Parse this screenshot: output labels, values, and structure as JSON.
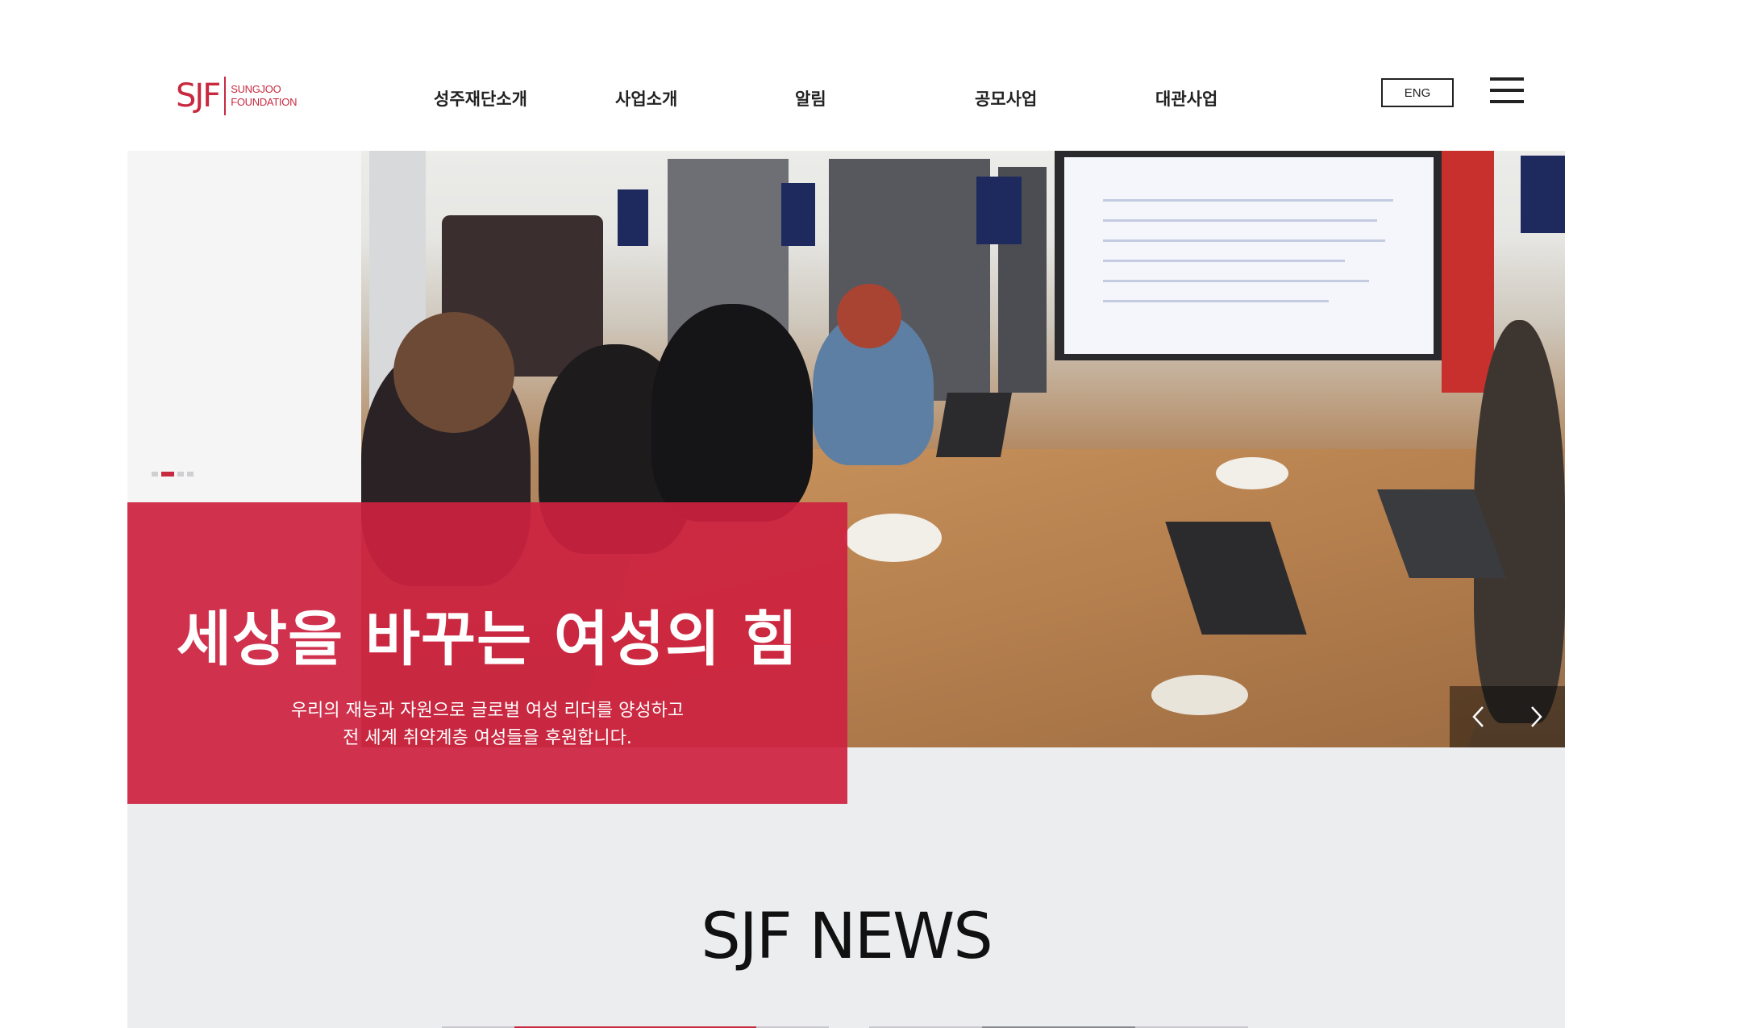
{
  "logo": {
    "mark": "SJF",
    "line1": "SUNGJOO",
    "line2": "FOUNDATION"
  },
  "nav": {
    "items": [
      {
        "label": "성주재단소개"
      },
      {
        "label": "사업소개"
      },
      {
        "label": "알림"
      },
      {
        "label": "공모사업"
      },
      {
        "label": "대관사업"
      }
    ]
  },
  "header": {
    "language_button": "ENG",
    "menu_icon": "hamburger-menu-icon"
  },
  "hero": {
    "title": "세상을 바꾸는 여성의 힘",
    "subtitle_line1": "우리의 재능과 자원으로 글로벌 여성 리더를 양성하고",
    "subtitle_line2": "전 세계 취약계층 여성들을 후원합니다.",
    "slide_count": 4,
    "active_slide": 2,
    "prev_icon": "chevron-left-icon",
    "next_icon": "chevron-right-icon"
  },
  "news": {
    "title": "SJF NEWS"
  },
  "colors": {
    "brand_red": "#c8293f",
    "caption_red": "#cd2240",
    "page_bg": "#ecedef"
  }
}
